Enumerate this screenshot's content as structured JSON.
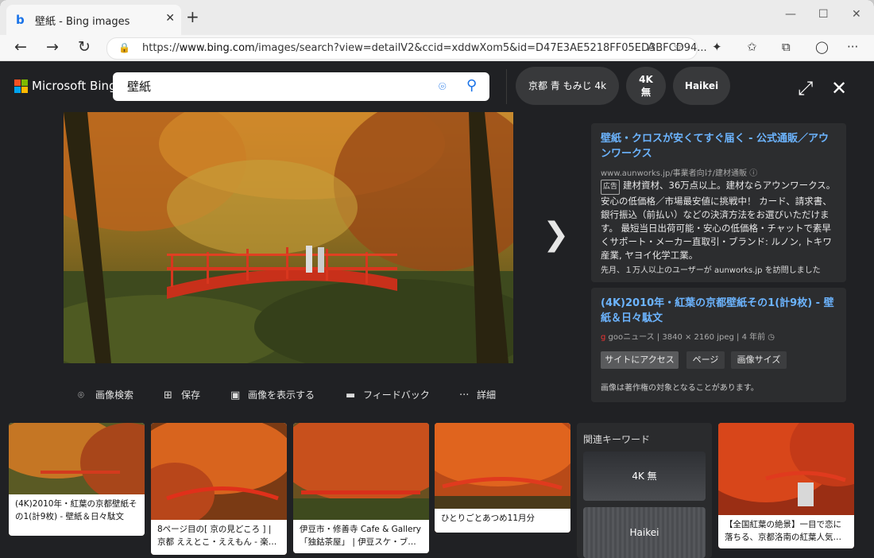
{
  "browser": {
    "tab_title": "壁紙 - Bing images",
    "tab_close": "✕",
    "new_tab": "+",
    "url_prefix": "https://",
    "url_domain": "www.bing.com",
    "url_rest": "/images/search?view=detailV2&ccid=xddwXom5&id=D47E3AE5218FF05ED3BFCD94...",
    "read_aloud": "Ã"
  },
  "bing": {
    "brand": "Microsoft Bing",
    "query": "壁紙",
    "chips": [
      {
        "label": "京都 青 もみじ 4k"
      },
      {
        "label_line1": "4K",
        "label_line2": "無"
      },
      {
        "label": "Haikei"
      }
    ]
  },
  "actions": [
    {
      "icon": "visual-search-icon",
      "label": "画像検索"
    },
    {
      "icon": "save-icon",
      "label": "保存"
    },
    {
      "icon": "view-image-icon",
      "label": "画像を表示する"
    },
    {
      "icon": "feedback-icon",
      "label": "フィードバック"
    },
    {
      "icon": "more-icon",
      "label": "詳細"
    }
  ],
  "ad_card": {
    "title": "壁紙・クロスが安くてすぐ届く - 公式通販／アウンワークス",
    "domain": "www.aunworks.jp/事業者向け/建材通販",
    "badge": "広告",
    "body": "建材資材、36万点以上。建材ならアウンワークス。安心の低価格／市場最安値に挑戦中！ カード、請求書、銀行振込（前払い）などの決済方法をお選びいただけます。 最短当日出荷可能・安心の低価格・チャットで素早くサポート・メーカー直取引・ブランド: ルノン, トキワ産業, ヤヨイ化学工業。",
    "visits": "先月、１万人以上のユーザーが aunworks.jp を訪問しました"
  },
  "image_card": {
    "title": "(4K)2010年・紅葉の京都壁紙その1(計9枚) - 壁紙＆日々駄文",
    "source": "gooニュース",
    "meta_size": "3840 × 2160 jpeg",
    "meta_time": "4 年前",
    "buttons": [
      "サイトにアクセス",
      "ページ",
      "画像サイズ"
    ],
    "copyright": "画像は著作権の対象となることがあります。"
  },
  "thumbs": [
    {
      "caption": "(4K)2010年・紅葉の京都壁紙その1(計9枚) - 壁紙＆日々駄文"
    },
    {
      "caption": "8ページ目の[ 京の見どころ ] | 京都 ええとこ・ええもん - 楽…"
    },
    {
      "caption": "伊豆市・修善寺 Cafe & Gallery「独鈷茶屋」 | 伊豆スケ・ブ…"
    },
    {
      "caption": "ひとりごとあつめ11月分"
    },
    {
      "caption": "【全国紅葉の絶景】一目で恋に落ちる、京都洛南の紅葉人気…"
    }
  ],
  "related": {
    "title": "関連キーワード",
    "items": [
      "4K 無",
      "Haikei"
    ]
  },
  "colors": {
    "link": "#6cb4ff",
    "bg": "#202124",
    "panel": "#2c2d2f"
  }
}
